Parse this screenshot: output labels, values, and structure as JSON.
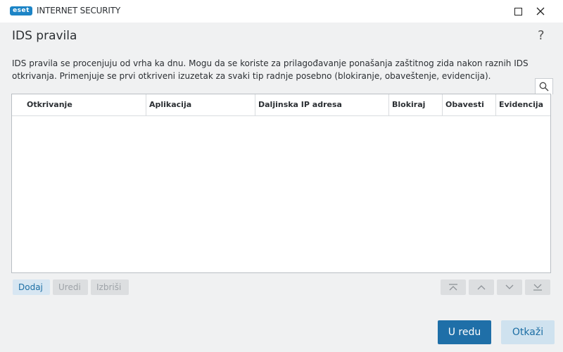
{
  "window": {
    "logo_text": "eset",
    "product_name": "INTERNET SECURITY"
  },
  "page": {
    "title": "IDS pravila",
    "help": "?",
    "description_line1": "IDS pravila se procenjuju od vrha ka dnu. Mogu da se koriste za prilagođavanje ponašanja zaštitnog zida nakon raznih IDS",
    "description_line2": "otkrivanja. Primenjuje se prvi otkriveni izuzetak za svaki tip radnje posebno (blokiranje, obaveštenje, evidencija)."
  },
  "table": {
    "columns": [
      "Otkrivanje",
      "Aplikacija",
      "Daljinska IP adresa",
      "Blokiraj",
      "Obavesti",
      "Evidencija"
    ],
    "rows": []
  },
  "actions": {
    "add": "Dodaj",
    "edit": "Uredi",
    "delete": "Izbriši"
  },
  "footer": {
    "ok": "U redu",
    "cancel": "Otkaži"
  },
  "icons": {
    "search": "search-icon",
    "move_top": "move-top-icon",
    "move_up": "move-up-icon",
    "move_down": "move-down-icon",
    "move_bottom": "move-bottom-icon"
  },
  "colors": {
    "accent": "#1f6fa8",
    "logo": "#1c84c6",
    "background": "#f0f1f2"
  }
}
